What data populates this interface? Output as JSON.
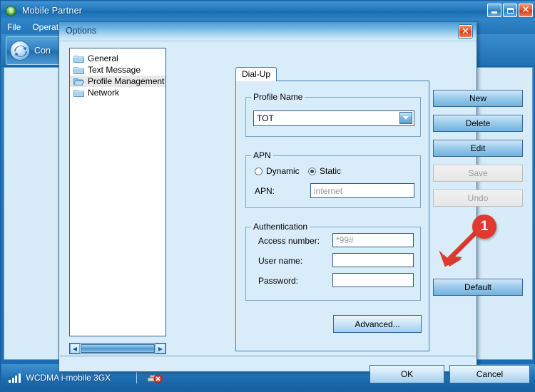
{
  "app": {
    "title": "Mobile Partner",
    "icon": "app-globe-icon",
    "window_buttons": {
      "minimize": "_",
      "maximize": "□",
      "close": "✕"
    },
    "menus": [
      "File",
      "Operati"
    ],
    "toolbar": {
      "connection_label": "Con",
      "connection_icon": "refresh-circle-icon"
    },
    "statusbar": {
      "network": "WCDMA i-mobile 3GX",
      "signal_bars": 4,
      "device_icon": "modem-disconnected-icon"
    }
  },
  "dialog": {
    "title": "Options",
    "close_label": "✕",
    "tree": {
      "items": [
        {
          "label": "General",
          "icon": "folder-closed-icon",
          "selected": false
        },
        {
          "label": "Text Message",
          "icon": "folder-closed-icon",
          "selected": false
        },
        {
          "label": "Profile Management",
          "icon": "folder-open-icon",
          "selected": true
        },
        {
          "label": "Network",
          "icon": "folder-closed-icon",
          "selected": false
        }
      ],
      "scrollbar": {
        "left_arrow": "◀",
        "right_arrow": "▶"
      }
    },
    "tabs": [
      {
        "label": "Dial-Up",
        "active": true
      }
    ],
    "profile_name": {
      "group_title": "Profile Name",
      "value": "TOT",
      "dropdown_icon": "chevron-down-icon"
    },
    "apn": {
      "group_title": "APN",
      "radio_dynamic": {
        "label": "Dynamic",
        "selected": false
      },
      "radio_static": {
        "label": "Static",
        "selected": true
      },
      "field_label": "APN:",
      "field_value": "internet",
      "field_is_placeholder": true
    },
    "authentication": {
      "group_title": "Authentication",
      "rows": [
        {
          "label": "Access number:",
          "value": "*99#",
          "is_placeholder": true
        },
        {
          "label": "User name:",
          "value": "",
          "is_placeholder": false
        },
        {
          "label": "Password:",
          "value": "",
          "is_placeholder": false
        }
      ]
    },
    "advanced_button": "Advanced...",
    "side_buttons": [
      {
        "label": "New",
        "disabled": false
      },
      {
        "label": "Delete",
        "disabled": false
      },
      {
        "label": "Edit",
        "disabled": false
      },
      {
        "label": "Save",
        "disabled": true
      },
      {
        "label": "Undo",
        "disabled": true
      }
    ],
    "default_button": {
      "label": "Default",
      "disabled": false
    },
    "footer_buttons": [
      {
        "label": "OK"
      },
      {
        "label": "Cancel"
      }
    ]
  },
  "annotation": {
    "badge_number": "1",
    "badge_color": "#e03a2f",
    "points_at": "Default"
  }
}
